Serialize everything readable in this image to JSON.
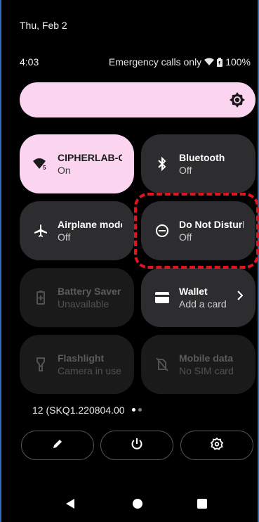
{
  "header": {
    "date": "Thu, Feb 2",
    "time": "4:03",
    "status_text": "Emergency calls only",
    "battery": "100%"
  },
  "tiles": {
    "wifi": {
      "title": "CIPHERLAB-G",
      "sub": "On",
      "icon": "wifi-icon"
    },
    "bluetooth": {
      "title": "Bluetooth",
      "sub": "Off",
      "icon": "bluetooth-icon"
    },
    "airplane": {
      "title": "Airplane mode",
      "sub": "Off",
      "icon": "airplane-icon"
    },
    "dnd": {
      "title": "Do Not Disturb",
      "sub": "Off",
      "icon": "dnd-icon"
    },
    "battery_saver": {
      "title": "Battery Saver",
      "sub": "Unavailable",
      "icon": "battery-saver-icon"
    },
    "wallet": {
      "title": "Wallet",
      "sub": "Add a card",
      "icon": "wallet-icon"
    },
    "flashlight": {
      "title": "Flashlight",
      "sub": "Camera in use",
      "icon": "flashlight-icon"
    },
    "mobile_data": {
      "title": "Mobile data",
      "sub": "No SIM card",
      "icon": "mobile-data-off-icon"
    }
  },
  "footer": {
    "build": "12 (SKQ1.220804.00"
  },
  "colors": {
    "accent": "#fbd5ef",
    "tile": "#2d2d2f",
    "highlight": "#e0141e"
  }
}
